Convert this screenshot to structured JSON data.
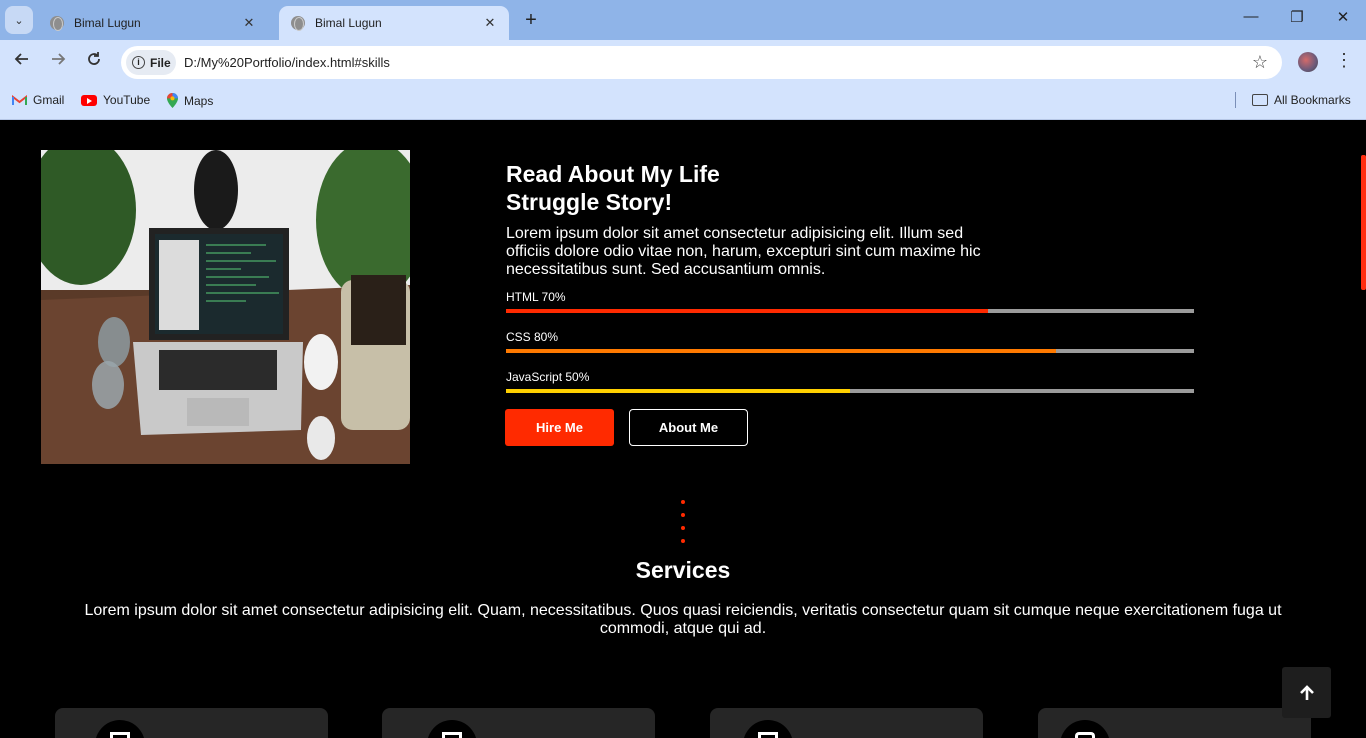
{
  "browser": {
    "tabs": [
      {
        "title": "Bimal Lugun",
        "active": false
      },
      {
        "title": "Bimal Lugun",
        "active": true
      }
    ],
    "new_tab_label": "+",
    "window_controls": {
      "minimize": "—",
      "restore": "❐",
      "close": "✕"
    },
    "address": {
      "chip_label": "File",
      "url": "D:/My%20Portfolio/index.html#skills"
    },
    "bookmarks": [
      {
        "label": "Gmail",
        "icon": "gmail-icon"
      },
      {
        "label": "YouTube",
        "icon": "youtube-icon"
      },
      {
        "label": "Maps",
        "icon": "maps-icon"
      }
    ],
    "all_bookmarks_label": "All Bookmarks"
  },
  "about": {
    "heading": "Read About My Life Struggle Story!",
    "text": "Lorem ipsum dolor sit amet consectetur adipisicing elit. Illum sed officiis dolore odio vitae non, harum, excepturi sint cum maxime hic necessitatibus sunt. Sed accusantium omnis.",
    "skills": [
      {
        "label": "HTML 70%",
        "percent": 70,
        "color": "#ff2a00"
      },
      {
        "label": "CSS 80%",
        "percent": 80,
        "color": "#ff7a00"
      },
      {
        "label": "JavaScript 50%",
        "percent": 50,
        "color": "#ffd000"
      }
    ],
    "hire_button": "Hire Me",
    "about_button": "About Me"
  },
  "services": {
    "title": "Services",
    "text": "Lorem ipsum dolor sit amet consectetur adipisicing elit. Quam, necessitatibus. Quos quasi reiciendis, veritatis consectetur quam sit cumque neque exercitationem fuga ut commodi, atque qui ad."
  },
  "colors": {
    "accent": "#ff2a00",
    "card_bg": "#262626",
    "page_bg": "#000000"
  },
  "back_to_top_icon": "arrow-up-icon"
}
